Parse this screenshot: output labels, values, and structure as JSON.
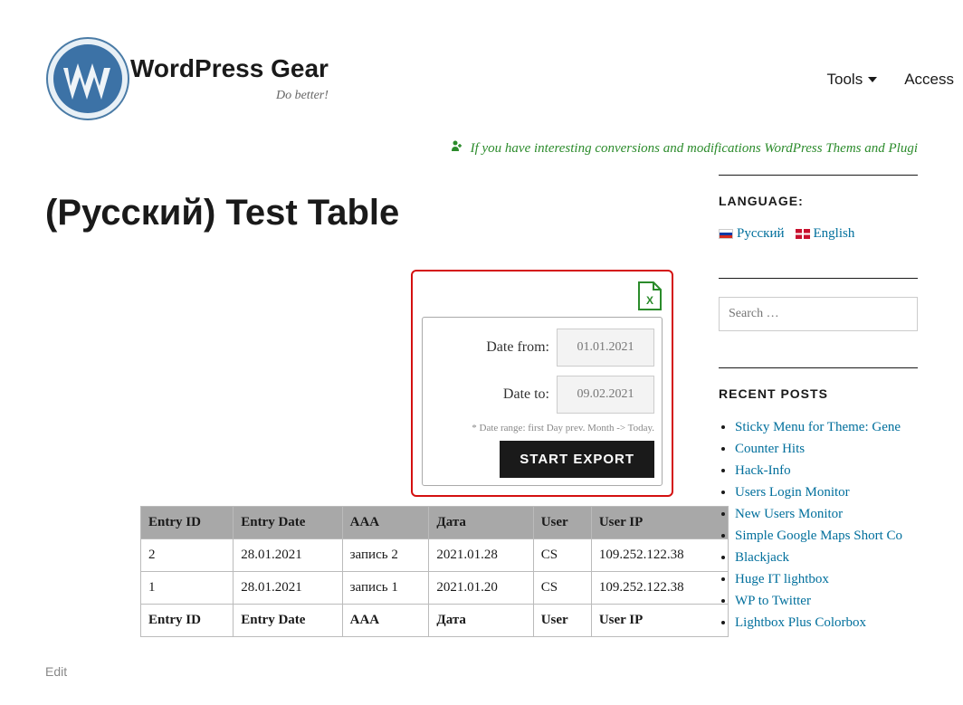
{
  "header": {
    "site_title": "WordPress Gear",
    "tagline": "Do better!"
  },
  "nav": {
    "tools": "Tools",
    "access": "Access"
  },
  "banner": {
    "text": "If you have interesting conversions and modifications WordPress Thems and Plugi"
  },
  "page": {
    "title": "(Русский) Test Table",
    "edit": "Edit"
  },
  "export": {
    "date_from_label": "Date from:",
    "date_from_value": "01.01.2021",
    "date_to_label": "Date to:",
    "date_to_value": "09.02.2021",
    "note": "* Date range: first Day prev. Month -> Today.",
    "button": "START EXPORT"
  },
  "table": {
    "headers": [
      "Entry ID",
      "Entry Date",
      "AAA",
      "Дата",
      "User",
      "User IP"
    ],
    "rows": [
      [
        "2",
        "28.01.2021",
        "запись 2",
        "2021.01.28",
        "CS",
        "109.252.122.38"
      ],
      [
        "1",
        "28.01.2021",
        "запись 1",
        "2021.01.20",
        "CS",
        "109.252.122.38"
      ]
    ],
    "footers": [
      "Entry ID",
      "Entry Date",
      "AAA",
      "Дата",
      "User",
      "User IP"
    ]
  },
  "sidebar": {
    "language": {
      "title": "LANGUAGE:",
      "ru": "Русский",
      "en": "English"
    },
    "search": {
      "placeholder": "Search …"
    },
    "recent": {
      "title": "RECENT POSTS",
      "items": [
        "Sticky Menu for Theme: Gene",
        "Counter Hits",
        "Hack-Info",
        "Users Login Monitor",
        "New Users Monitor",
        "Simple Google Maps Short Co",
        "Blackjack",
        "Huge IT lightbox",
        "WP to Twitter",
        "Lightbox Plus Colorbox"
      ]
    }
  }
}
